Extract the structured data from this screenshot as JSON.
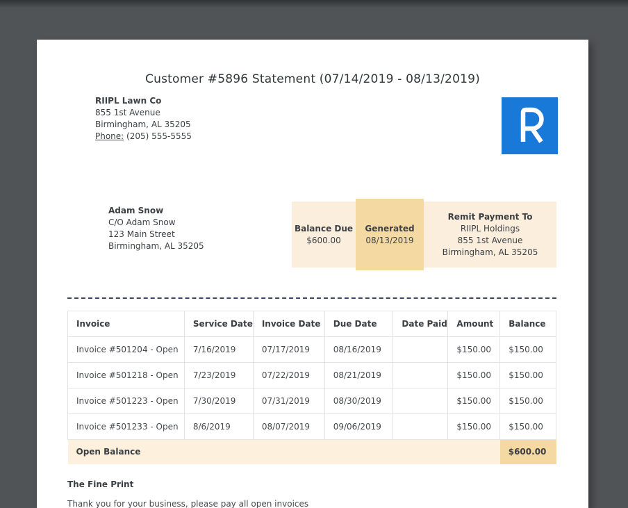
{
  "title": "Customer #5896 Statement (07/14/2019 - 08/13/2019)",
  "company": {
    "name": "RIIPL Lawn Co",
    "address1": "855 1st Avenue",
    "address2": "Birmingham, AL 35205",
    "phone_label": "Phone:",
    "phone_number": "(205) 555-5555"
  },
  "logo": {
    "letter": "R"
  },
  "customer": {
    "name": "Adam Snow",
    "care_of": "C/O Adam Snow",
    "street": "123 Main Street",
    "city": "Birmingham, AL 35205"
  },
  "summary": {
    "balance_due": {
      "label": "Balance Due",
      "value": "$600.00"
    },
    "generated": {
      "label": "Generated",
      "value": "08/13/2019"
    },
    "remit": {
      "label": "Remit Payment To",
      "name": "RIIPL Holdings",
      "address1": "855 1st Avenue",
      "address2": "Birmingham, AL 35205"
    }
  },
  "invoice_table": {
    "headers": [
      "Invoice",
      "Service Date",
      "Invoice Date",
      "Due Date",
      "Date Paid",
      "Amount",
      "Balance"
    ],
    "rows": [
      [
        "Invoice #501204 - Open",
        "7/16/2019",
        "07/17/2019",
        "08/16/2019",
        "",
        "$150.00",
        "$150.00"
      ],
      [
        "Invoice #501218 - Open",
        "7/23/2019",
        "07/22/2019",
        "08/21/2019",
        "",
        "$150.00",
        "$150.00"
      ],
      [
        "Invoice #501223 - Open",
        "7/30/2019",
        "07/31/2019",
        "08/30/2019",
        "",
        "$150.00",
        "$150.00"
      ],
      [
        "Invoice #501233 - Open",
        "8/6/2019",
        "08/07/2019",
        "09/06/2019",
        "",
        "$150.00",
        "$150.00"
      ]
    ],
    "footer": {
      "label": "Open Balance",
      "value": "$600.00"
    }
  },
  "fine_print": {
    "heading": "The Fine Print",
    "message": "Thank you for your business, please pay all open invoices"
  },
  "colors": {
    "accent_blue": "#1879d8",
    "panel_cream_light": "#fbeedc",
    "panel_cream_dark": "#f5d9a2",
    "open_balance_row": "#fdf0dc",
    "viewer_background": "#515457"
  }
}
